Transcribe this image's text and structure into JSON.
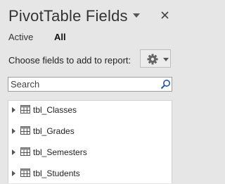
{
  "panel": {
    "title": "PivotTable Fields",
    "tabs": [
      {
        "label": "Active",
        "selected": false
      },
      {
        "label": "All",
        "selected": true
      }
    ],
    "choose_label": "Choose fields to add to report:",
    "search": {
      "value": "",
      "placeholder": "Search"
    },
    "fields": [
      {
        "label": "tbl_Classes"
      },
      {
        "label": "tbl_Grades"
      },
      {
        "label": "tbl_Semesters"
      },
      {
        "label": "tbl_Students"
      }
    ]
  },
  "icons": {
    "title_menu": "chevron-down-icon",
    "close": "close-icon",
    "settings": "gear-icon",
    "search": "search-icon",
    "expand": "expand-triangle-icon",
    "table": "table-icon"
  },
  "colors": {
    "panel_bg": "#e6e6e6",
    "list_bg": "#ffffff",
    "text": "#222222",
    "search_icon": "#2b579a"
  }
}
